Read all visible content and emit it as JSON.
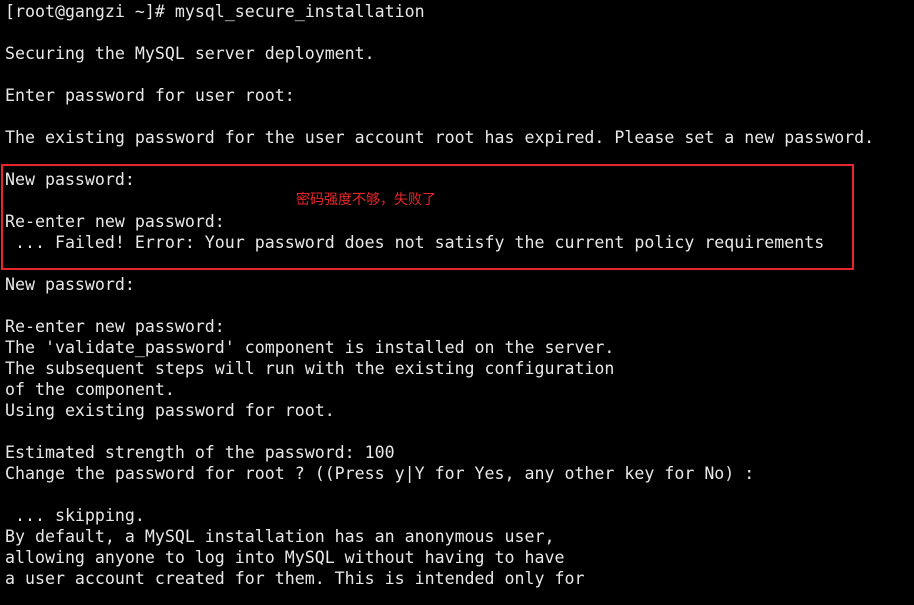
{
  "colors": {
    "background": "#000000",
    "text": "#e8e8e8",
    "highlight": "#e8262a"
  },
  "terminal": {
    "lines": [
      "[root@gangzi ~]# mysql_secure_installation",
      "",
      "Securing the MySQL server deployment.",
      "",
      "Enter password for user root:",
      "",
      "The existing password for the user account root has expired. Please set a new password.",
      "",
      "New password:",
      "",
      "Re-enter new password:",
      " ... Failed! Error: Your password does not satisfy the current policy requirements",
      "",
      "New password:",
      "",
      "Re-enter new password:",
      "The 'validate_password' component is installed on the server.",
      "The subsequent steps will run with the existing configuration",
      "of the component.",
      "Using existing password for root.",
      "",
      "Estimated strength of the password: 100",
      "Change the password for root ? ((Press y|Y for Yes, any other key for No) :",
      "",
      " ... skipping.",
      "By default, a MySQL installation has an anonymous user,",
      "allowing anyone to log into MySQL without having to have",
      "a user account created for them. This is intended only for"
    ]
  },
  "annotation": {
    "text": "密码强度不够，失败了"
  }
}
